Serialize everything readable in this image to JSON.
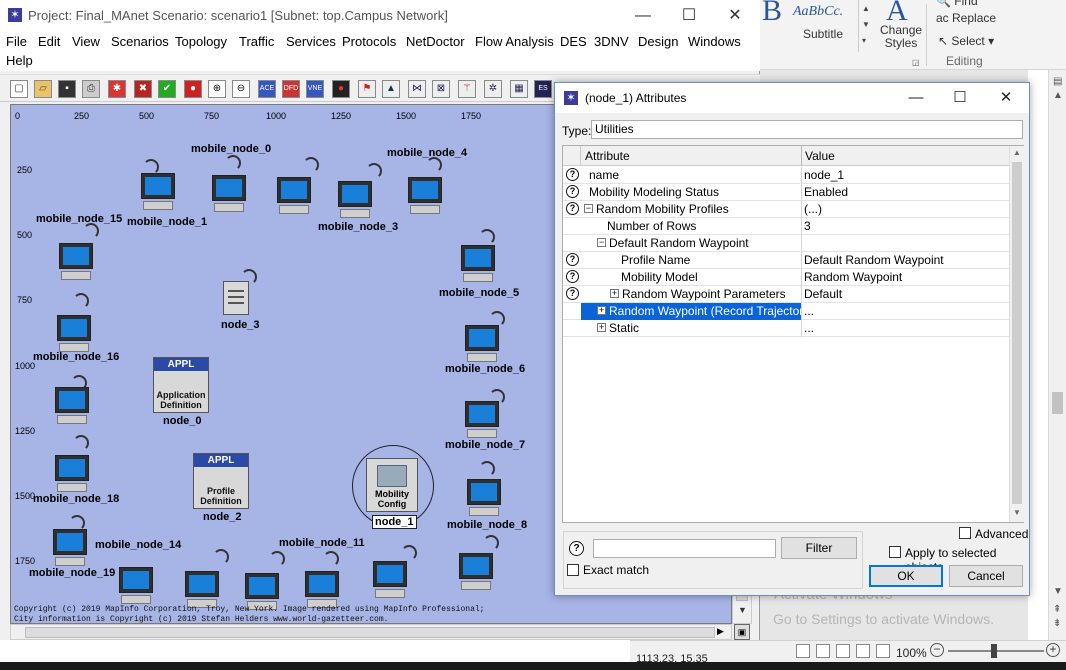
{
  "opnet": {
    "title": "Project: Final_MAnet Scenario: scenario1  [Subnet: top.Campus Network]",
    "window_controls": {
      "minimize": "—",
      "maximize": "☐",
      "close": "✕"
    },
    "menu": [
      "File",
      "Edit",
      "View",
      "Scenarios",
      "Topology",
      "Traffic",
      "Services",
      "Protocols",
      "NetDoctor",
      "Flow Analysis",
      "DES",
      "3DNV",
      "Design",
      "Windows",
      "Help"
    ],
    "toolbar_icons": [
      "new-icon",
      "open-icon",
      "save-icon",
      "print-icon",
      "bug-icon",
      "delete-icon",
      "validate-icon",
      "config-icon",
      "zoom-in-icon",
      "zoom-out-icon",
      "ace-icon",
      "dfd-icon",
      "vne-icon",
      "traffic-light-icon",
      "failure-icon",
      "triangle-icon",
      "select-icon",
      "grid-icon",
      "wand-icon",
      "network-icon",
      "server-icon"
    ],
    "toolbar_text": {
      "ace": "ACE",
      "dfd": "DFD",
      "vne": "VNE",
      "es": "ES"
    },
    "ruler_x": [
      "0",
      "250",
      "500",
      "750",
      "1000",
      "1250",
      "1500",
      "1750"
    ],
    "ruler_y": [
      "250",
      "500",
      "750",
      "1000",
      "1250",
      "1500",
      "1750"
    ],
    "nodes": {
      "mobile_node_0": "mobile_node_0",
      "mobile_node_1": "mobile_node_1",
      "mobile_node_3": "mobile_node_3",
      "mobile_node_4": "mobile_node_4",
      "mobile_node_5": "mobile_node_5",
      "mobile_node_6": "mobile_node_6",
      "mobile_node_7": "mobile_node_7",
      "mobile_node_8": "mobile_node_8",
      "mobile_node_11": "mobile_node_11",
      "mobile_node_14": "mobile_node_14",
      "mobile_node_15": "mobile_node_15",
      "mobile_node_16": "mobile_node_16",
      "mobile_node_18": "mobile_node_18",
      "mobile_node_19": "mobile_node_19",
      "node_0": "node_0",
      "node_1": "node_1",
      "node_2": "node_2",
      "node_3": "node_3"
    },
    "appl_header": "APPL",
    "app_def_text": "Application Definition",
    "profile_def_text": "Profile Definition",
    "mobility_text": "Mobility Config",
    "copyright_line1": "Copyright (c) 2019 MapInfo Corporation, Troy, New York. Image rendered using MapInfo Professional;",
    "copyright_line2": "City information is Copyright (c) 2019 Stefan Helders www.world-gazetteer.com."
  },
  "dialog": {
    "title": "(node_1) Attributes",
    "type_label": "Type:",
    "type_value": "Utilities",
    "col_attribute": "Attribute",
    "col_value": "Value",
    "rows": [
      {
        "name": "name",
        "value": "node_1"
      },
      {
        "name": "Mobility Modeling Status",
        "value": "Enabled"
      },
      {
        "name": "Random Mobility Profiles",
        "value": "(...)"
      },
      {
        "name": "Number of Rows",
        "value": "3"
      },
      {
        "name": "Default Random Waypoint",
        "value": ""
      },
      {
        "name": "Profile Name",
        "value": "Default Random Waypoint"
      },
      {
        "name": "Mobility Model",
        "value": "Random Waypoint"
      },
      {
        "name": "Random Waypoint Parameters",
        "value": "Default"
      },
      {
        "name": "Random Waypoint (Record Trajectory)",
        "value": "..."
      },
      {
        "name": "Static",
        "value": "..."
      }
    ],
    "filter_button": "Filter",
    "exact_match": "Exact match",
    "advanced": "Advanced",
    "apply_selected": "Apply to selected objects",
    "ok": "OK",
    "cancel": "Cancel"
  },
  "word": {
    "style_sample_b": "B",
    "style_sample": "AaBbCc.",
    "subtitle": "Subtitle",
    "change_styles": "Change Styles",
    "find": "Find",
    "replace": "Replace",
    "select": "Select",
    "editing": "Editing",
    "activate_line1": "Activate Windows",
    "activate_line2": "Go to Settings to activate Windows.",
    "zoom": "100%",
    "coords": "1113.23, 15.35"
  }
}
